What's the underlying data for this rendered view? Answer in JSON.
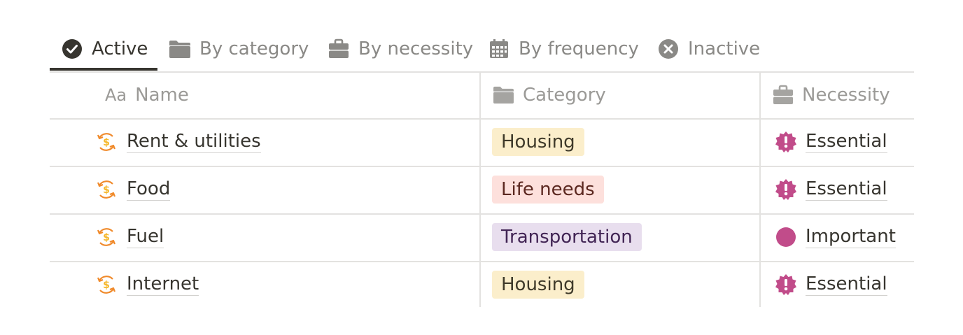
{
  "tabs": [
    {
      "label": "Active",
      "icon": "check-circle-icon",
      "active": true
    },
    {
      "label": "By category",
      "icon": "folder-icon"
    },
    {
      "label": "By necessity",
      "icon": "briefcase-icon"
    },
    {
      "label": "By frequency",
      "icon": "calendar-icon"
    },
    {
      "label": "Inactive",
      "icon": "x-circle-icon"
    }
  ],
  "columns": {
    "name": {
      "prefix": "Aa",
      "label": "Name"
    },
    "category": {
      "label": "Category",
      "icon": "folder-icon"
    },
    "necessity": {
      "label": "Necessity",
      "icon": "briefcase-icon"
    }
  },
  "rows": [
    {
      "name": "Rent & utilities",
      "category": "Housing",
      "necessity": "Essential"
    },
    {
      "name": "Food",
      "category": "Life needs",
      "necessity": "Essential"
    },
    {
      "name": "Fuel",
      "category": "Transportation",
      "necessity": "Important"
    },
    {
      "name": "Internet",
      "category": "Housing",
      "necessity": "Essential"
    }
  ],
  "colors": {
    "housing_bg": "#fbeecb",
    "housing_fg": "#3f3a2a",
    "life_needs_bg": "#fde0dc",
    "life_needs_fg": "#5c2820",
    "transportation_bg": "#e8deee",
    "transportation_fg": "#412454",
    "necessity_icon": "#c14c8a",
    "money_icon": "#f08a2b"
  }
}
